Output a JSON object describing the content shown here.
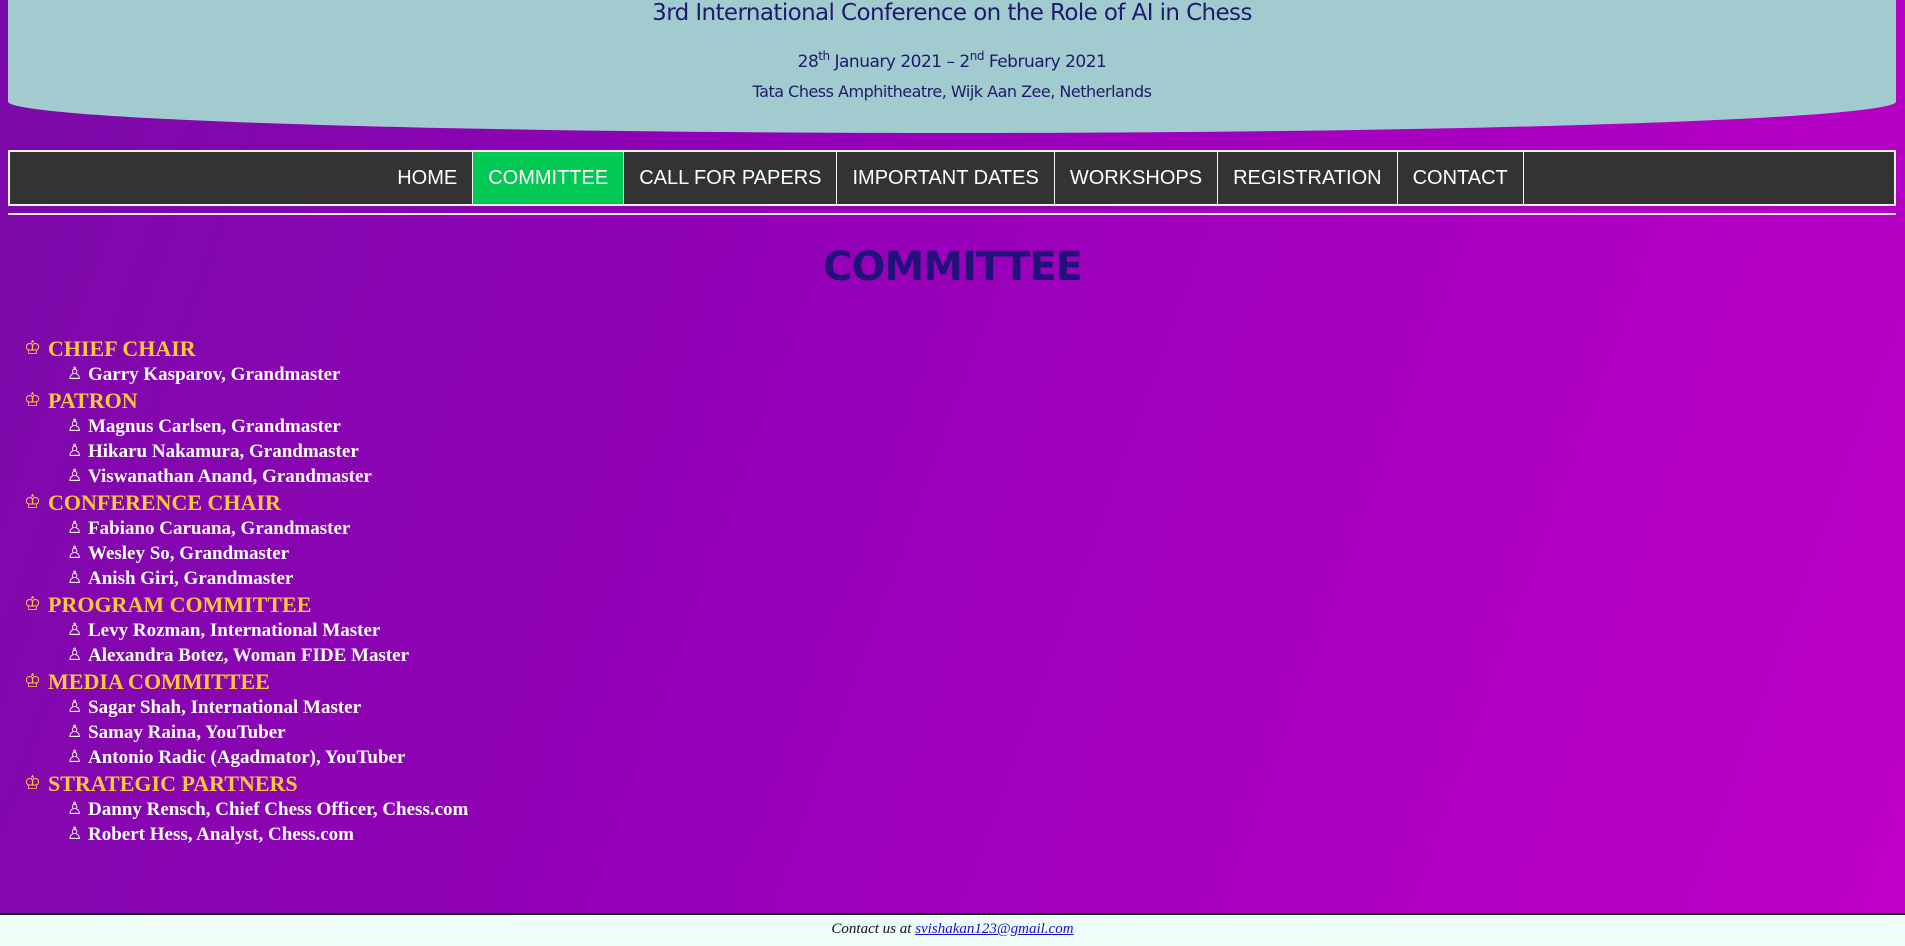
{
  "header": {
    "title": "3rd International Conference on the Role of AI in Chess",
    "date_start_day": "28",
    "date_start_suffix": "th",
    "date_start_rest": " January 2021 – 2",
    "date_end_suffix": "nd",
    "date_end_rest": " February 2021",
    "venue": "Tata Chess Amphitheatre, Wijk Aan Zee, Netherlands"
  },
  "nav": {
    "items": [
      "HOME",
      "COMMITTEE",
      "CALL FOR PAPERS",
      "IMPORTANT DATES",
      "WORKSHOPS",
      "REGISTRATION",
      "CONTACT"
    ],
    "active": "COMMITTEE"
  },
  "page_title": "COMMITTEE",
  "icons": {
    "group": "crown-icon",
    "member": "pawn-icon"
  },
  "colors": {
    "group_heading": "#ffc83a",
    "member_text": "#ffffff",
    "active_nav": "#00c853",
    "nav_bg": "#333333"
  },
  "committee": [
    {
      "heading": "CHIEF CHAIR",
      "members": [
        "Garry Kasparov, Grandmaster"
      ]
    },
    {
      "heading": "PATRON",
      "members": [
        "Magnus Carlsen, Grandmaster",
        "Hikaru Nakamura, Grandmaster",
        "Viswanathan Anand, Grandmaster"
      ]
    },
    {
      "heading": "CONFERENCE CHAIR",
      "members": [
        "Fabiano Caruana, Grandmaster",
        "Wesley So, Grandmaster",
        "Anish Giri, Grandmaster"
      ]
    },
    {
      "heading": "PROGRAM COMMITTEE",
      "members": [
        "Levy Rozman, International Master",
        "Alexandra Botez, Woman FIDE Master"
      ]
    },
    {
      "heading": "MEDIA COMMITTEE",
      "members": [
        "Sagar Shah, International Master",
        "Samay Raina, YouTuber",
        "Antonio Radic (Agadmator), YouTuber"
      ]
    },
    {
      "heading": "STRATEGIC PARTNERS",
      "members": [
        "Danny Rensch, Chief Chess Officer, Chess.com",
        "Robert Hess, Analyst, Chess.com"
      ]
    }
  ],
  "footer": {
    "text": "Contact us at ",
    "email": "svishakan123@gmail.com"
  }
}
